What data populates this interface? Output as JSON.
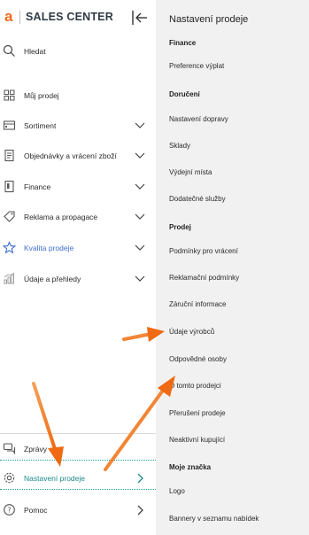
{
  "app": {
    "logo_mark": "a",
    "title": "SALES CENTER"
  },
  "colors": {
    "accent": "#f36b1c",
    "active": "#1b8a8a",
    "link_blue": "#3d6fd0",
    "panel_bg": "#f1f1f1"
  },
  "sidebar": {
    "items": [
      {
        "label": "Hledat",
        "icon": "search-icon"
      },
      {
        "label": "Můj prodej",
        "icon": "grid-icon"
      },
      {
        "label": "Sortiment",
        "icon": "box-icon"
      },
      {
        "label": "Objednávky a vrácení zboží",
        "icon": "document-icon"
      },
      {
        "label": "Finance",
        "icon": "finance-icon"
      },
      {
        "label": "Reklama a propagace",
        "icon": "tag-icon"
      },
      {
        "label": "Kvalita prodeje",
        "icon": "star-icon"
      },
      {
        "label": "Údaje a přehledy",
        "icon": "chart-icon"
      }
    ],
    "bottom": [
      {
        "label": "Zprávy",
        "icon": "chat-icon"
      },
      {
        "label": "Nastavení prodeje",
        "icon": "gear-icon"
      },
      {
        "label": "Pomoc",
        "icon": "help-icon"
      }
    ]
  },
  "panel": {
    "title": "Nastavení prodeje",
    "sections": [
      {
        "heading": "Finance",
        "links": [
          "Preference výplat"
        ]
      },
      {
        "heading": "Doručení",
        "links": [
          "Nastavení dopravy",
          "Sklady",
          "Výdejní místa",
          "Dodatečné služby"
        ]
      },
      {
        "heading": "Prodej",
        "links": [
          "Podmínky pro vrácení",
          "Reklamační podmínky",
          "Záruční informace",
          "Údaje výrobců",
          "Odpovědné osoby",
          "O tomto prodejci",
          "Přerušení prodeje",
          "Neaktivní kupující"
        ]
      },
      {
        "heading": "Moje značka",
        "links": [
          "Logo",
          "Bannery v seznamu nabídek"
        ]
      }
    ]
  }
}
